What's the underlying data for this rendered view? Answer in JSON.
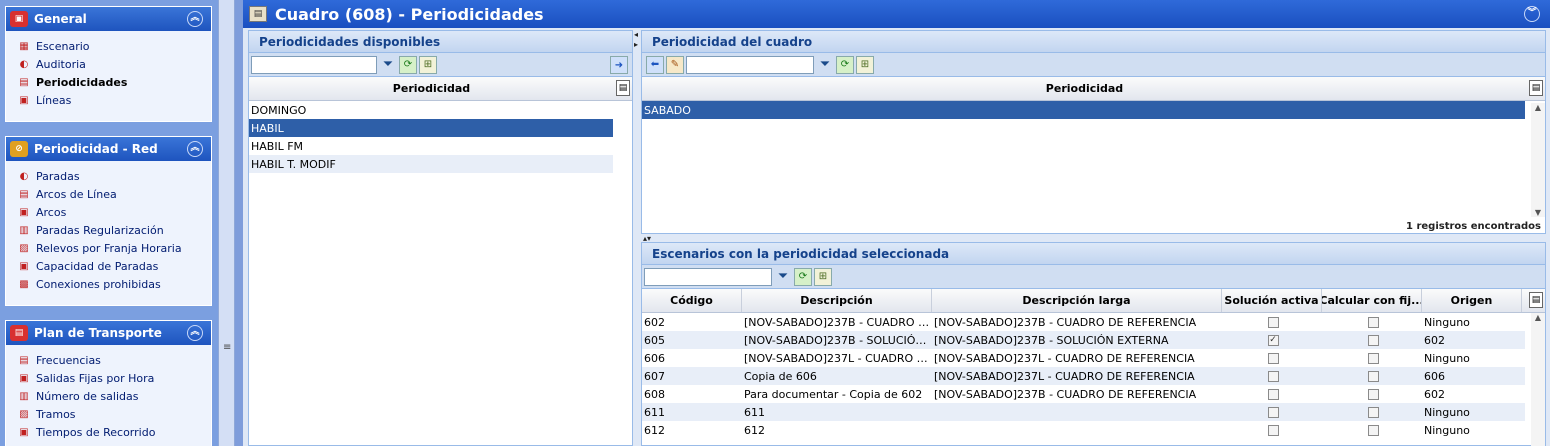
{
  "sidebar": {
    "groups": [
      {
        "title": "General",
        "items": [
          {
            "label": "Escenario",
            "icon": "scenario-icon"
          },
          {
            "label": "Auditoria",
            "icon": "audit-icon"
          },
          {
            "label": "Periodicidades",
            "icon": "periodicity-icon"
          },
          {
            "label": "Líneas",
            "icon": "bus-icon"
          }
        ]
      },
      {
        "title": "Periodicidad - Red",
        "items": [
          {
            "label": "Paradas"
          },
          {
            "label": "Arcos de Línea"
          },
          {
            "label": "Arcos"
          },
          {
            "label": "Paradas Regularización"
          },
          {
            "label": "Relevos por Franja Horaria"
          },
          {
            "label": "Capacidad de Paradas"
          },
          {
            "label": "Conexiones prohibidas"
          }
        ]
      },
      {
        "title": "Plan de Transporte",
        "items": [
          {
            "label": "Frecuencias"
          },
          {
            "label": "Salidas Fijas por Hora"
          },
          {
            "label": "Número de salidas"
          },
          {
            "label": "Tramos"
          },
          {
            "label": "Tiempos de Recorrido"
          }
        ]
      }
    ]
  },
  "window": {
    "title": "Cuadro (608) - Periodicidades"
  },
  "available": {
    "title": "Periodicidades disponibles",
    "search_value": "",
    "column": "Periodicidad",
    "rows": [
      "DOMINGO",
      "HABIL",
      "HABIL FM",
      "HABIL T. MODIF"
    ],
    "selected_index": 1
  },
  "assigned": {
    "title": "Periodicidad del cuadro",
    "search_value": "",
    "column": "Periodicidad",
    "rows": [
      "SABADO"
    ],
    "selected_index": 0,
    "status": "1 registros encontrados"
  },
  "scenarios": {
    "title": "Escenarios con la periodicidad seleccionada",
    "search_value": "",
    "columns": [
      "Código",
      "Descripción",
      "Descripción larga",
      "Solución activa",
      "Calcular con fij...",
      "Origen"
    ],
    "rows": [
      {
        "codigo": "602",
        "desc": "[NOV-SABADO]237B - CUADRO DE ...",
        "larga": "[NOV-SABADO]237B - CUADRO DE REFERENCIA",
        "activa": false,
        "fijas": false,
        "origen": "Ninguno"
      },
      {
        "codigo": "605",
        "desc": "[NOV-SABADO]237B - SOLUCIÓN EX...",
        "larga": "[NOV-SABADO]237B - SOLUCIÓN EXTERNA",
        "activa": true,
        "fijas": false,
        "origen": "602"
      },
      {
        "codigo": "606",
        "desc": "[NOV-SABADO]237L - CUADRO DE ...",
        "larga": "[NOV-SABADO]237L - CUADRO DE REFERENCIA",
        "activa": false,
        "fijas": false,
        "origen": "Ninguno"
      },
      {
        "codigo": "607",
        "desc": "Copia de 606",
        "larga": "[NOV-SABADO]237L - CUADRO DE REFERENCIA",
        "activa": false,
        "fijas": false,
        "origen": "606"
      },
      {
        "codigo": "608",
        "desc": "Para documentar - Copia de 602",
        "larga": "[NOV-SABADO]237B - CUADRO DE REFERENCIA",
        "activa": false,
        "fijas": false,
        "origen": "602"
      },
      {
        "codigo": "611",
        "desc": "611",
        "larga": "",
        "activa": false,
        "fijas": false,
        "origen": "Ninguno"
      },
      {
        "codigo": "612",
        "desc": "612",
        "larga": "",
        "activa": false,
        "fijas": false,
        "origen": "Ninguno"
      }
    ]
  }
}
